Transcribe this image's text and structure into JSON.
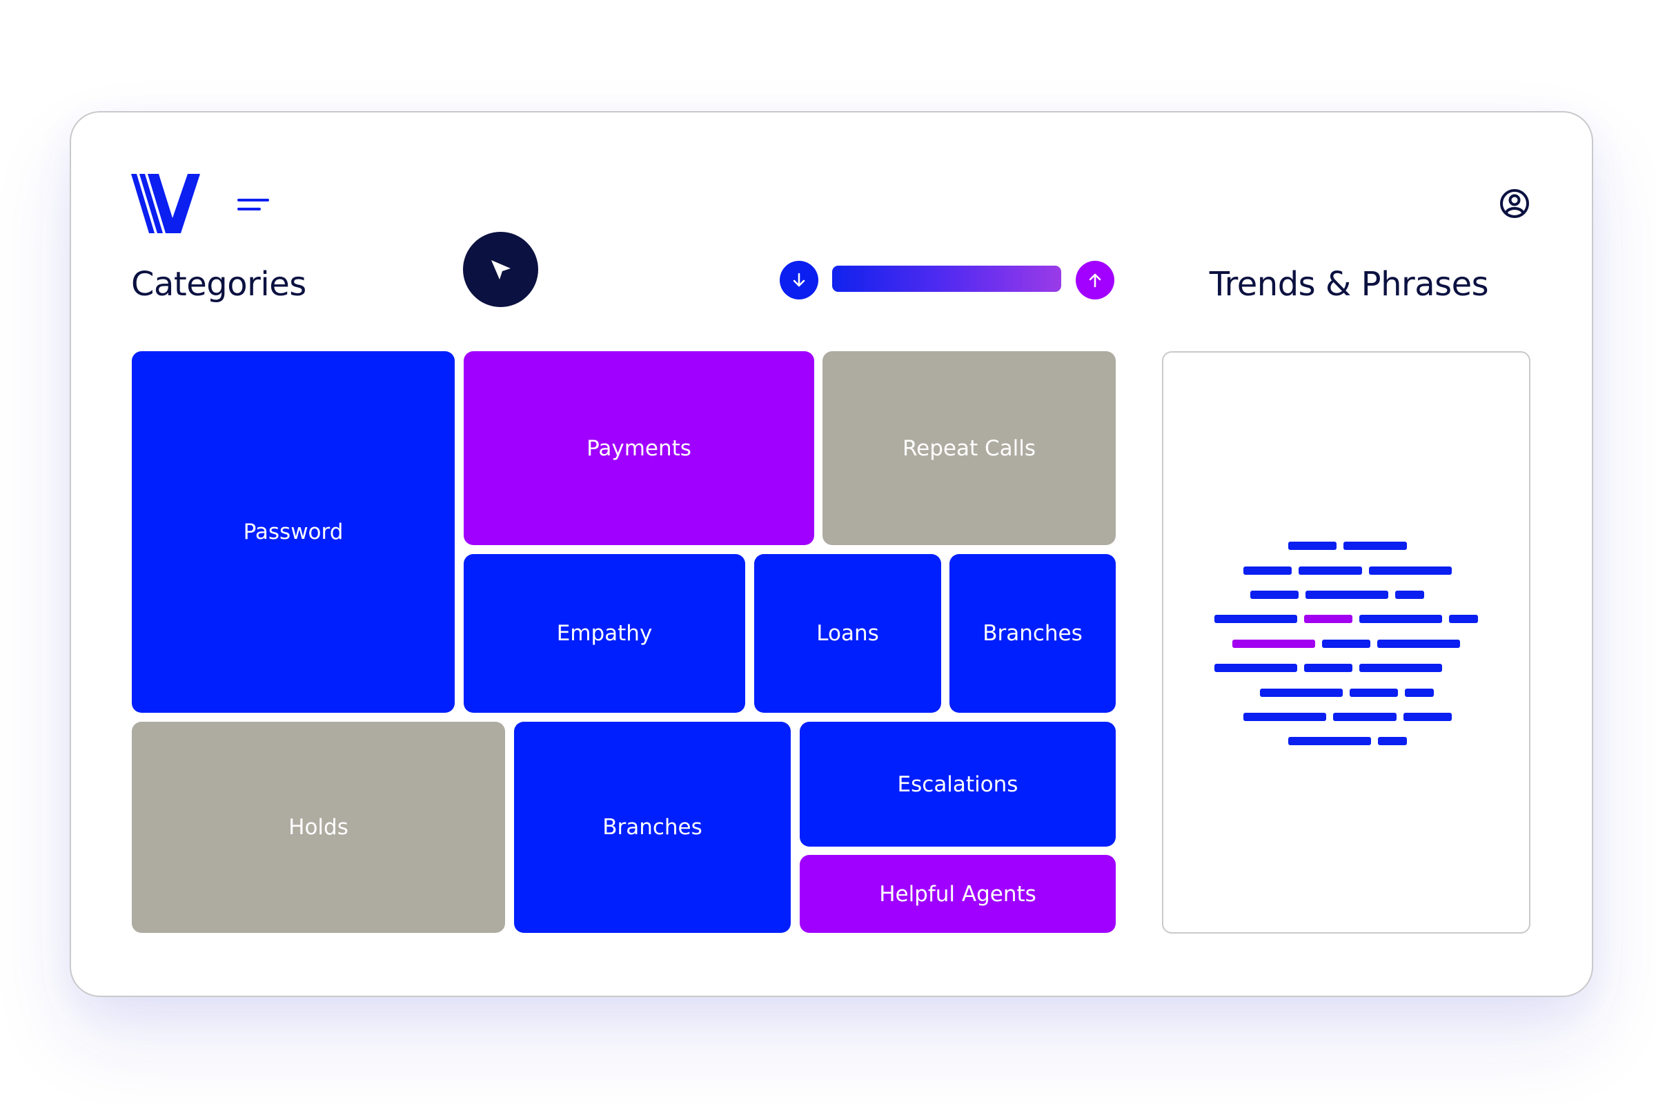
{
  "header": {
    "logo_icon": "brand-v-logo",
    "menu_icon": "hamburger-menu-icon",
    "user_icon": "user-account-icon"
  },
  "categories": {
    "title": "Categories",
    "cursor_icon": "pointer-arrow-icon",
    "sort": {
      "down_icon": "arrow-down-icon",
      "up_icon": "arrow-up-icon"
    },
    "tiles": [
      {
        "label": "Password",
        "color": "#001ffe"
      },
      {
        "label": "Payments",
        "color": "#a000ff"
      },
      {
        "label": "Repeat Calls",
        "color": "#aeaba1"
      },
      {
        "label": "Empathy",
        "color": "#001ffe"
      },
      {
        "label": "Loans",
        "color": "#001ffe"
      },
      {
        "label": "Branches",
        "color": "#001ffe"
      },
      {
        "label": "Holds",
        "color": "#aeaba1"
      },
      {
        "label": "Branches",
        "color": "#001ffe"
      },
      {
        "label": "Escalations",
        "color": "#001ffe"
      },
      {
        "label": "Helpful Agents",
        "color": "#a000ff"
      }
    ]
  },
  "trends": {
    "title": "Trends & Phrases",
    "word_cloud_icon": "phrase-cloud-graphic"
  },
  "colors": {
    "primary": "#001ffe",
    "accent": "#a000ff",
    "neutral": "#aeaba1",
    "dark": "#0b1140"
  }
}
